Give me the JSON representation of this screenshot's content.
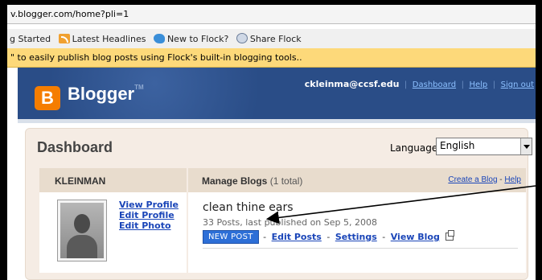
{
  "browser": {
    "url": "v.blogger.com/home?pli=1",
    "bookmarks": [
      {
        "label": "g Started",
        "icon": "none"
      },
      {
        "label": "Latest Headlines",
        "icon": "rss-icon"
      },
      {
        "label": "New to Flock?",
        "icon": "flock-bird-icon"
      },
      {
        "label": "Share Flock",
        "icon": "share-icon"
      }
    ],
    "infobar": "\" to easily publish blog posts using Flock's built-in blogging tools.."
  },
  "header": {
    "logo_letter": "B",
    "logo_text": "Blogger",
    "logo_tm": "TM",
    "user_email": "ckleinma@ccsf.edu",
    "links": [
      "Dashboard",
      "Help",
      "Sign out"
    ],
    "link_separator": "|"
  },
  "dashboard": {
    "title": "Dashboard",
    "language_label": "Language:",
    "language_value": "English"
  },
  "profile": {
    "name": "KLEINMAN",
    "links": [
      "View Profile",
      "Edit Profile",
      "Edit Photo"
    ]
  },
  "blogs": {
    "heading": "Manage Blogs",
    "count": "(1 total)",
    "create_link": "Create a Blog",
    "help_link": "Help",
    "dash": "-",
    "items": [
      {
        "title": "clean thine ears",
        "meta": "33 Posts, last published on Sep 5, 2008",
        "new_post": "NEW POST",
        "actions": [
          "Edit Posts",
          "Settings",
          "View Blog"
        ]
      }
    ]
  },
  "colors": {
    "header_bg": "#2a4d87",
    "logo_orange": "#f57d00",
    "link_blue": "#1a45b8",
    "panel_bg": "#f5ece4",
    "infobar_bg": "#fdd97a"
  }
}
